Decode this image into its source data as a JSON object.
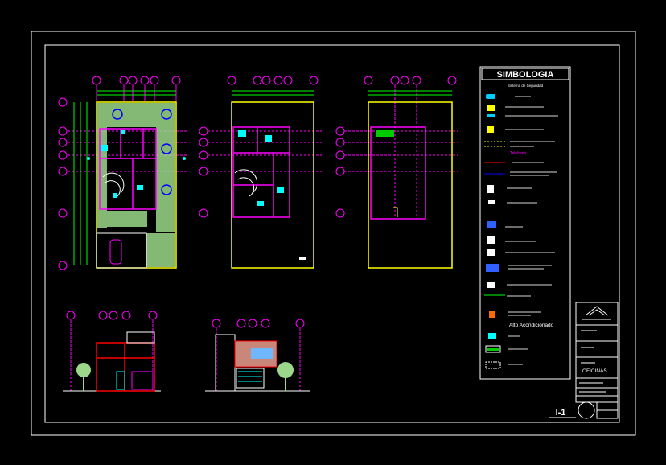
{
  "legend": {
    "title": "SIMBOLOGIA",
    "subtitle": "Sistema de Seguridad",
    "section_telefonia": "Telefonia",
    "alto_acondicionado": "Alto Acondicionado"
  },
  "title_block": {
    "proyecto_value": "OFICINAS",
    "sheet_number": "I-1"
  },
  "colors": {
    "frame": "#ffffff",
    "plan_outline": "#ffff00",
    "walls": "#ff00ff",
    "grid_lines": "#ff00ff",
    "dimension": "#00ff00",
    "vegetation": "#9bd88a",
    "legend_text": "#ffffff"
  }
}
